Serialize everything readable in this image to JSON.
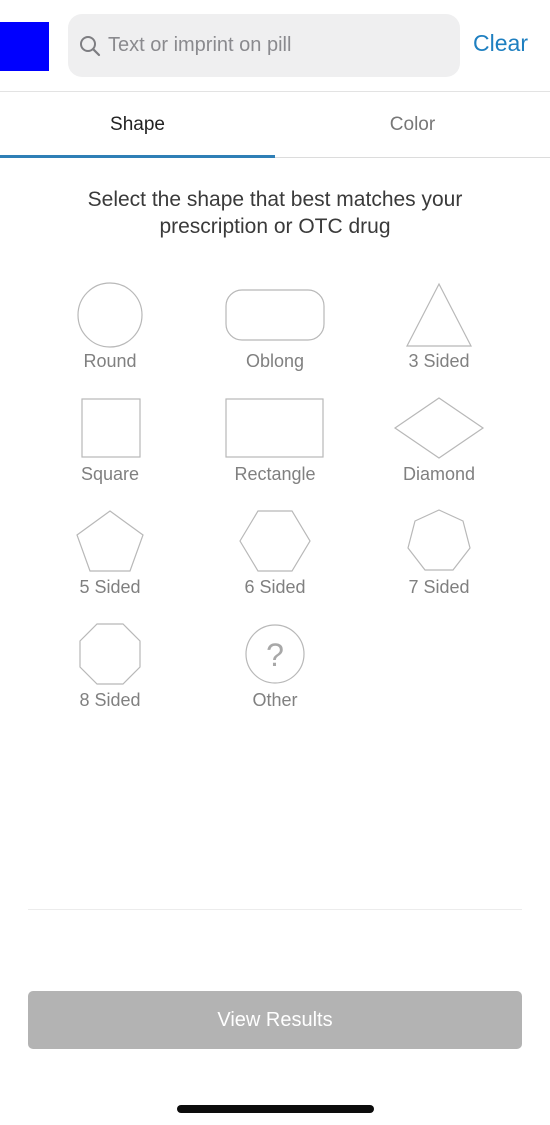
{
  "search": {
    "placeholder": "Text or imprint on pill",
    "clear_label": "Clear"
  },
  "tabs": [
    {
      "label": "Shape"
    },
    {
      "label": "Color"
    }
  ],
  "instruction": "Select the shape that best matches your prescription or OTC drug",
  "shapes": [
    {
      "label": "Round",
      "icon": "round-icon"
    },
    {
      "label": "Oblong",
      "icon": "oblong-icon"
    },
    {
      "label": "3 Sided",
      "icon": "triangle-icon"
    },
    {
      "label": "Square",
      "icon": "square-icon"
    },
    {
      "label": "Rectangle",
      "icon": "rectangle-icon"
    },
    {
      "label": "Diamond",
      "icon": "diamond-icon"
    },
    {
      "label": "5 Sided",
      "icon": "pentagon-icon"
    },
    {
      "label": "6 Sided",
      "icon": "hexagon-icon"
    },
    {
      "label": "7 Sided",
      "icon": "heptagon-icon"
    },
    {
      "label": "8 Sided",
      "icon": "octagon-icon"
    },
    {
      "label": "Other",
      "icon": "question-mark-icon",
      "glyph": "?"
    }
  ],
  "footer": {
    "view_results_label": "View Results"
  },
  "colors": {
    "accent": "#1e7fc0",
    "tab_indicator": "#2f7fb6",
    "disabled_button": "#b3b3b3",
    "shape_stroke": "#b8b8b8"
  }
}
